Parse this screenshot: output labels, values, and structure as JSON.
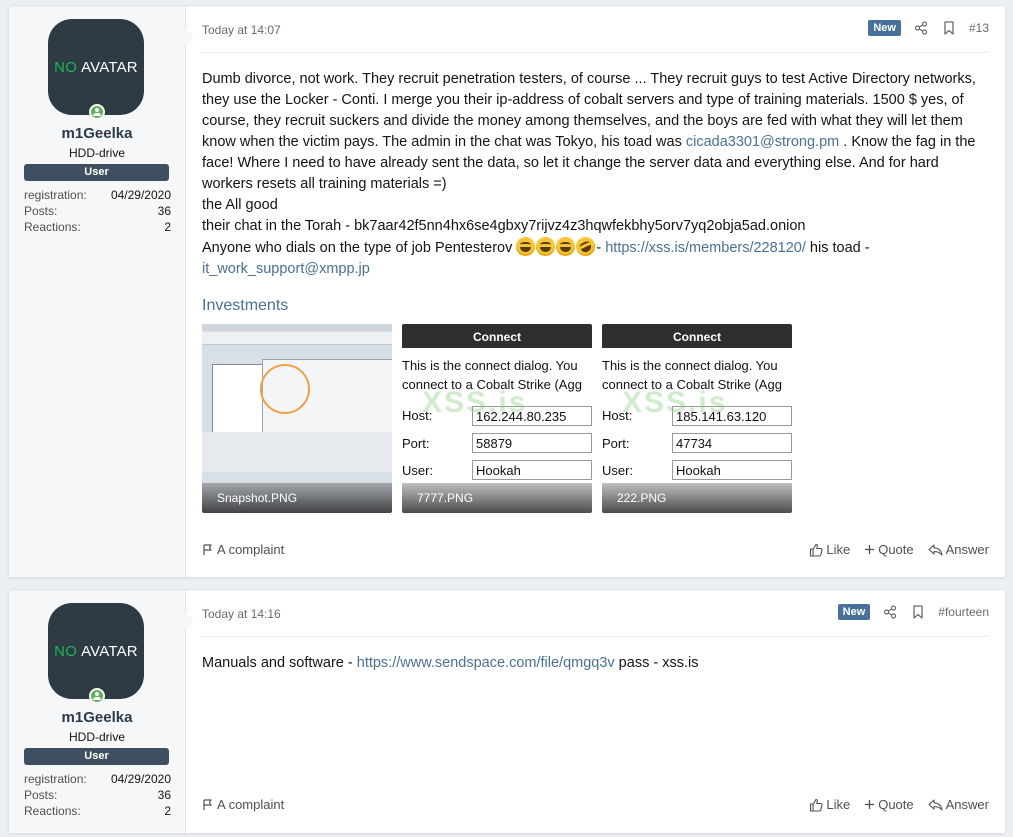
{
  "posts": [
    {
      "user": {
        "avatar_no": "NO",
        "avatar_text": "AVATAR",
        "name": "m1Geelka",
        "title": "HDD-drive",
        "banner": "User",
        "stats": [
          {
            "label": "registration:",
            "value": "04/29/2020"
          },
          {
            "label": "Posts:",
            "value": "36"
          },
          {
            "label": "Reactions:",
            "value": "2"
          }
        ]
      },
      "timestamp": "Today at 14:07",
      "badge": "New",
      "number": "#13",
      "body": {
        "para1": "Dumb divorce, not work. They recruit penetration testers, of course ... They recruit guys to test Active Directory networks, they use the Locker - Conti. I merge you their ip-address of cobalt servers and type of training materials. 1500 $ yes, of course, they recruit suckers and divide the money among themselves, and the boys are fed with what they will let them know when the victim pays. The admin in the chat was Tokyo, his toad was ",
        "email1": "cicada3301@strong.pm",
        "para1_end": " . Know the fag in the face! Where I need to have already sent the data, so let it change the server data and everything else. And for hard workers resets all training materials =)",
        "line2": "the All good",
        "line3": "their chat in the Torah - bk7aar42f5nn4hx6se4gbxy7rijvz4z3hqwfekbhy5orv7yq2obja5ad.onion",
        "line4_start": "Anyone who dials on the type of job Pentesterov ",
        "line4_dash": "- ",
        "link1": "https://xss.is/members/228120/",
        "line4_mid": " his toad -",
        "email2": "it_work_support@xmpp.jp"
      },
      "attachments_title": "Investments",
      "attachments": [
        {
          "name": "Snapshot.PNG"
        },
        {
          "name": "7777.PNG",
          "header": "Connect",
          "text1": "This is the connect dialog. You",
          "text2": "connect to a Cobalt Strike (Agg",
          "host_label": "Host:",
          "host": "162.244.80.235",
          "port_label": "Port:",
          "port": "58879",
          "user_label": "User:",
          "user": "Hookah",
          "watermark": "XSS.is"
        },
        {
          "name": "222.PNG",
          "header": "Connect",
          "text1": "This is the connect dialog. You",
          "text2": "connect to a Cobalt Strike (Agg",
          "host_label": "Host:",
          "host": "185.141.63.120",
          "port_label": "Port:",
          "port": "47734",
          "user_label": "User:",
          "user": "Hookah",
          "watermark": "XSS.is"
        }
      ],
      "footer": {
        "complaint": "A complaint",
        "like": "Like",
        "quote": "Quote",
        "answer": "Answer"
      }
    },
    {
      "user": {
        "avatar_no": "NO",
        "avatar_text": "AVATAR",
        "name": "m1Geelka",
        "title": "HDD-drive",
        "banner": "User",
        "stats": [
          {
            "label": "registration:",
            "value": "04/29/2020"
          },
          {
            "label": "Posts:",
            "value": "36"
          },
          {
            "label": "Reactions:",
            "value": "2"
          }
        ]
      },
      "timestamp": "Today at 14:16",
      "badge": "New",
      "number": "#fourteen",
      "body": {
        "text_start": "Manuals and software - ",
        "link": "https://www.sendspace.com/file/qmgq3v",
        "text_end": " pass - xss.is"
      },
      "footer": {
        "complaint": "A complaint",
        "like": "Like",
        "quote": "Quote",
        "answer": "Answer"
      }
    }
  ],
  "colors": {
    "link": "#47719b",
    "banner": "#3e4f60",
    "badge": "#47719b",
    "avatar_bg": "#2d3b45",
    "avatar_no": "#1fb45a",
    "online": "#63b257"
  },
  "icons": [
    "share-icon",
    "bookmark-icon",
    "flag-icon",
    "thumbs-up-icon",
    "plus-icon",
    "reply-icon",
    "online-status-icon",
    "emoji-grinning-icon",
    "emoji-rofl-icon"
  ]
}
